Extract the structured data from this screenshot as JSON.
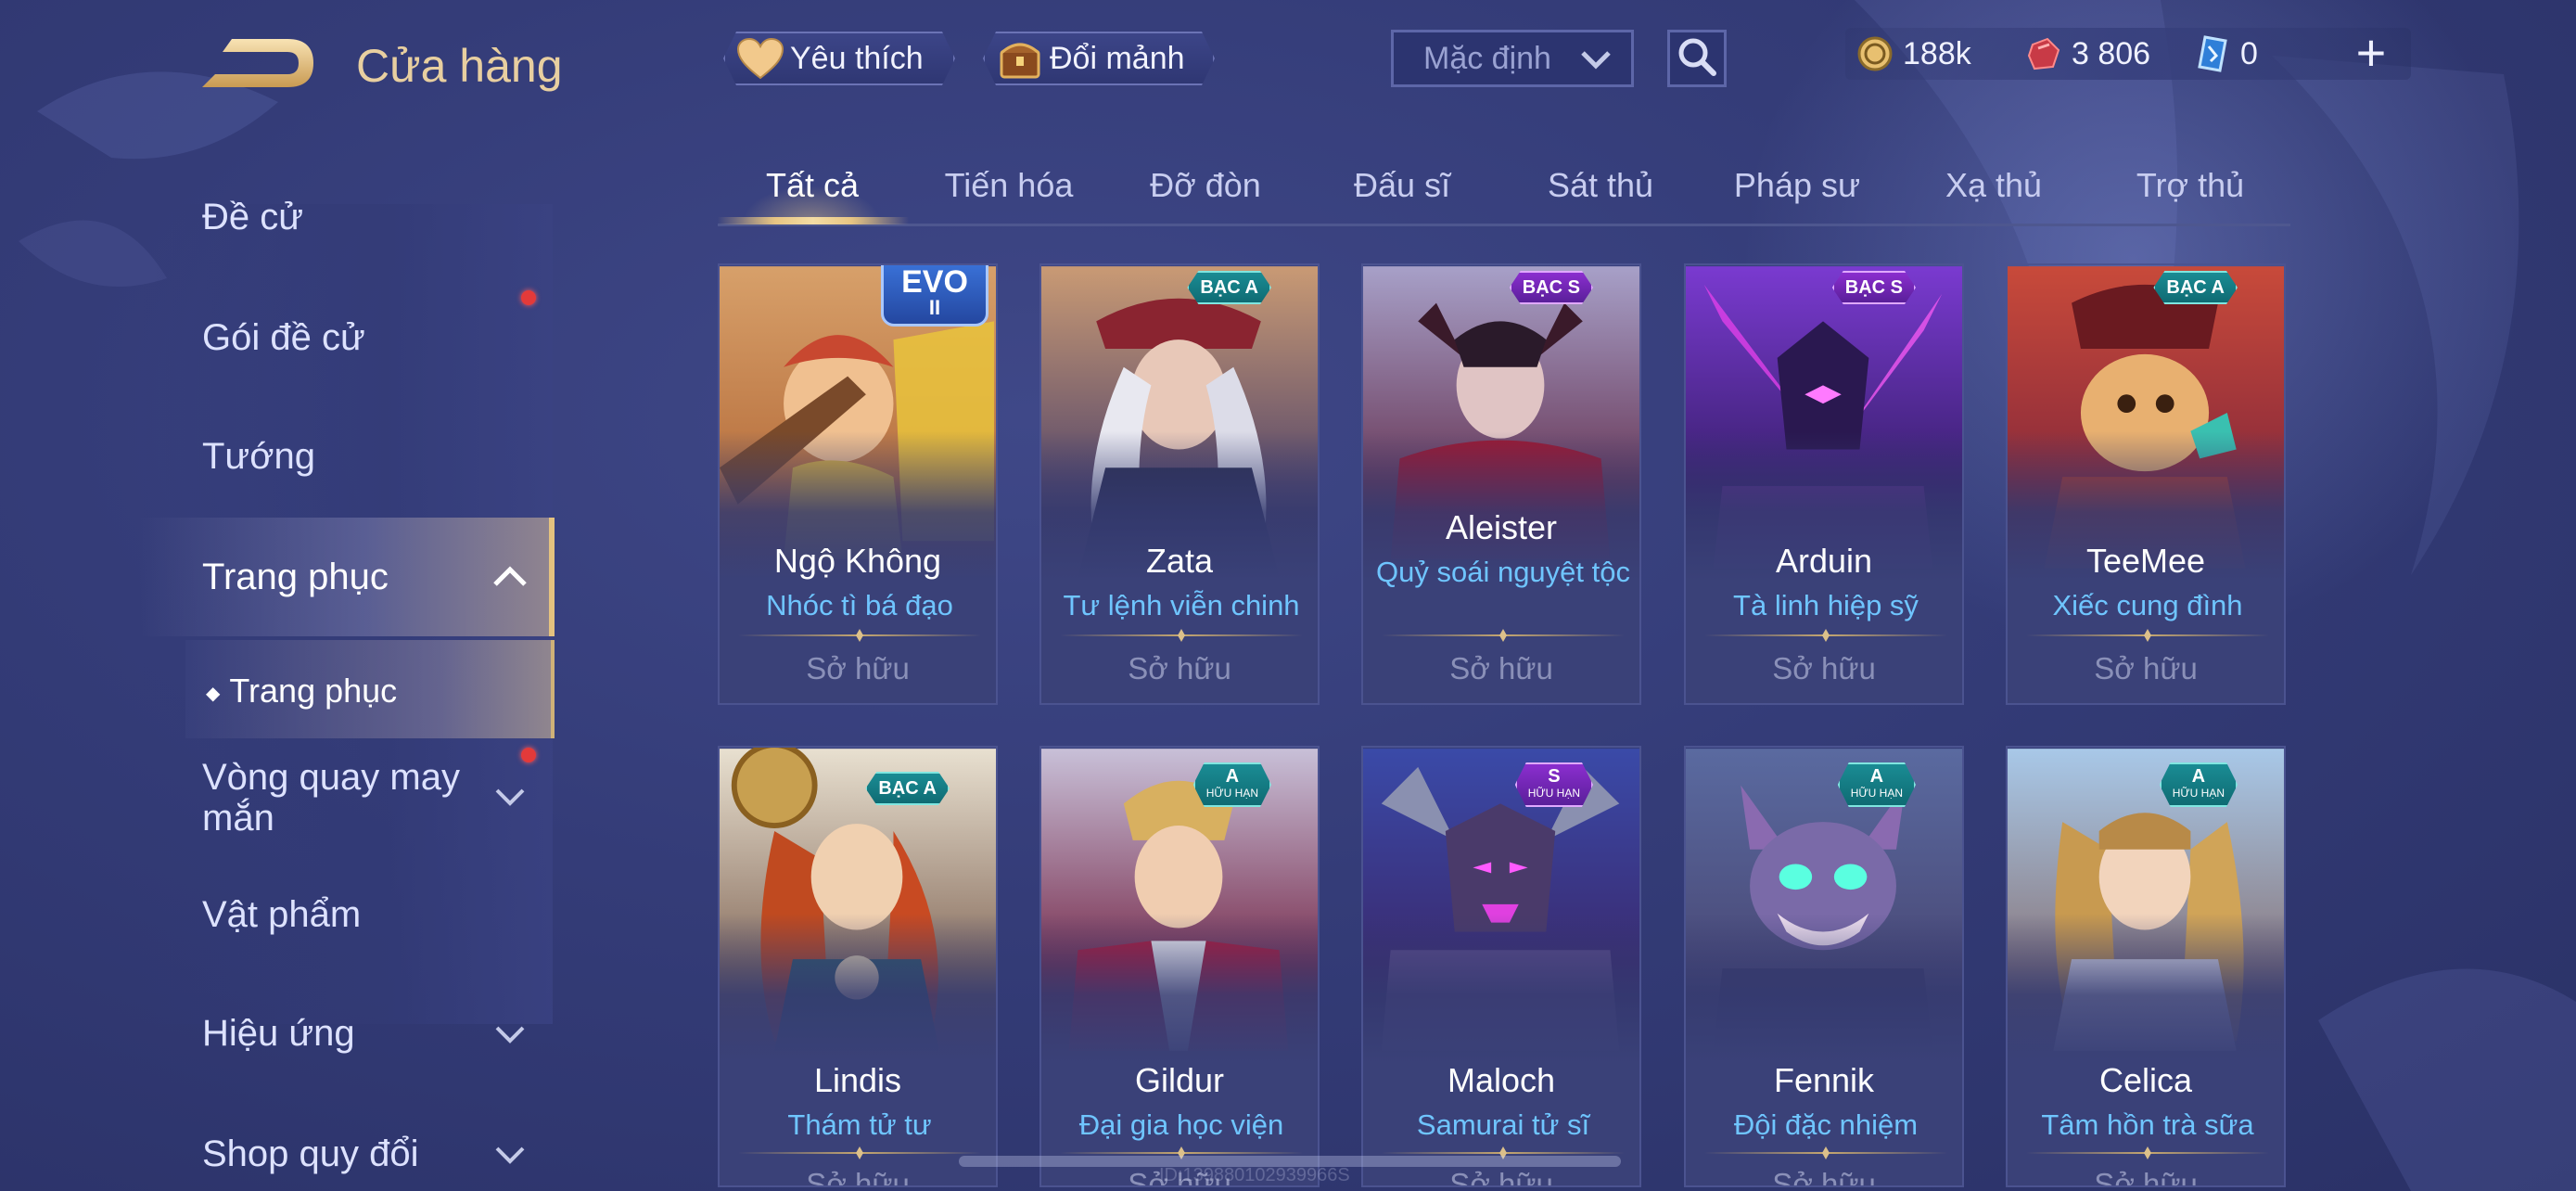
{
  "header": {
    "title": "Cửa hàng",
    "favorite_label": "Yêu thích",
    "shard_label": "Đổi mảnh",
    "sort_value": "Mặc định",
    "currencies": {
      "gold": "188k",
      "ruby": "3 806",
      "voucher": "0"
    },
    "plus_symbol": "+"
  },
  "sidebar": {
    "items": [
      {
        "label": "Đề cử"
      },
      {
        "label": "Gói đề cử"
      },
      {
        "label": "Tướng"
      },
      {
        "label": "Trang phục"
      },
      {
        "label": "Vòng quay may mắn"
      },
      {
        "label": "Vật phẩm"
      },
      {
        "label": "Hiệu ứng"
      },
      {
        "label": "Shop quy đổi"
      }
    ],
    "sub_item": "Trang phục",
    "sub_bullet": "◆"
  },
  "tabs": [
    {
      "label": "Tất cả"
    },
    {
      "label": "Tiến hóa"
    },
    {
      "label": "Đỡ đòn"
    },
    {
      "label": "Đấu sĩ"
    },
    {
      "label": "Sát thủ"
    },
    {
      "label": "Pháp sư"
    },
    {
      "label": "Xạ thủ"
    },
    {
      "label": "Trợ thủ"
    }
  ],
  "cards": [
    {
      "hero": "Ngộ Không",
      "skin": "Nhóc tì bá đạo",
      "status": "Sở hữu",
      "badge": "EVO",
      "badge_sub": "II"
    },
    {
      "hero": "Zata",
      "skin": "Tư lệnh viễn chinh",
      "status": "Sở hữu",
      "badge": "BẠC A",
      "badge_sub": ""
    },
    {
      "hero": "Aleister",
      "skin": "Quỷ soái nguyệt tộc",
      "status": "Sở hữu",
      "badge": "BẠC S",
      "badge_sub": ""
    },
    {
      "hero": "Arduin",
      "skin": "Tà linh hiệp sỹ",
      "status": "Sở hữu",
      "badge": "BẠC S",
      "badge_sub": ""
    },
    {
      "hero": "TeeMee",
      "skin": "Xiếc cung đình",
      "status": "Sở hữu",
      "badge": "BẠC A",
      "badge_sub": ""
    },
    {
      "hero": "Lindis",
      "skin": "Thám tử tư",
      "status": "Sở hữu",
      "badge": "BẠC A",
      "badge_sub": ""
    },
    {
      "hero": "Gildur",
      "skin": "Đại gia học viện",
      "status": "Sở hữu",
      "badge": "A",
      "badge_sub": "HỮU HẠN"
    },
    {
      "hero": "Maloch",
      "skin": "Samurai tử sĩ",
      "status": "Sở hữu",
      "badge": "S",
      "badge_sub": "HỮU HẠN"
    },
    {
      "hero": "Fennik",
      "skin": "Đội đặc nhiệm",
      "status": "Sở hữu",
      "badge": "A",
      "badge_sub": "HỮU HẠN"
    },
    {
      "hero": "Celica",
      "skin": "Tâm hồn trà sữa",
      "status": "Sở hữu",
      "badge": "A",
      "badge_sub": "HỮU HẠN"
    }
  ],
  "watermark": "ID:139880102939966S",
  "colors": {
    "accent_gold": "#e8cfa0",
    "skin_name_blue": "#6fc5ff",
    "badge_teal": "#1a8c94",
    "badge_purple": "#8b2ecf",
    "notification_red": "#e33a3a"
  }
}
